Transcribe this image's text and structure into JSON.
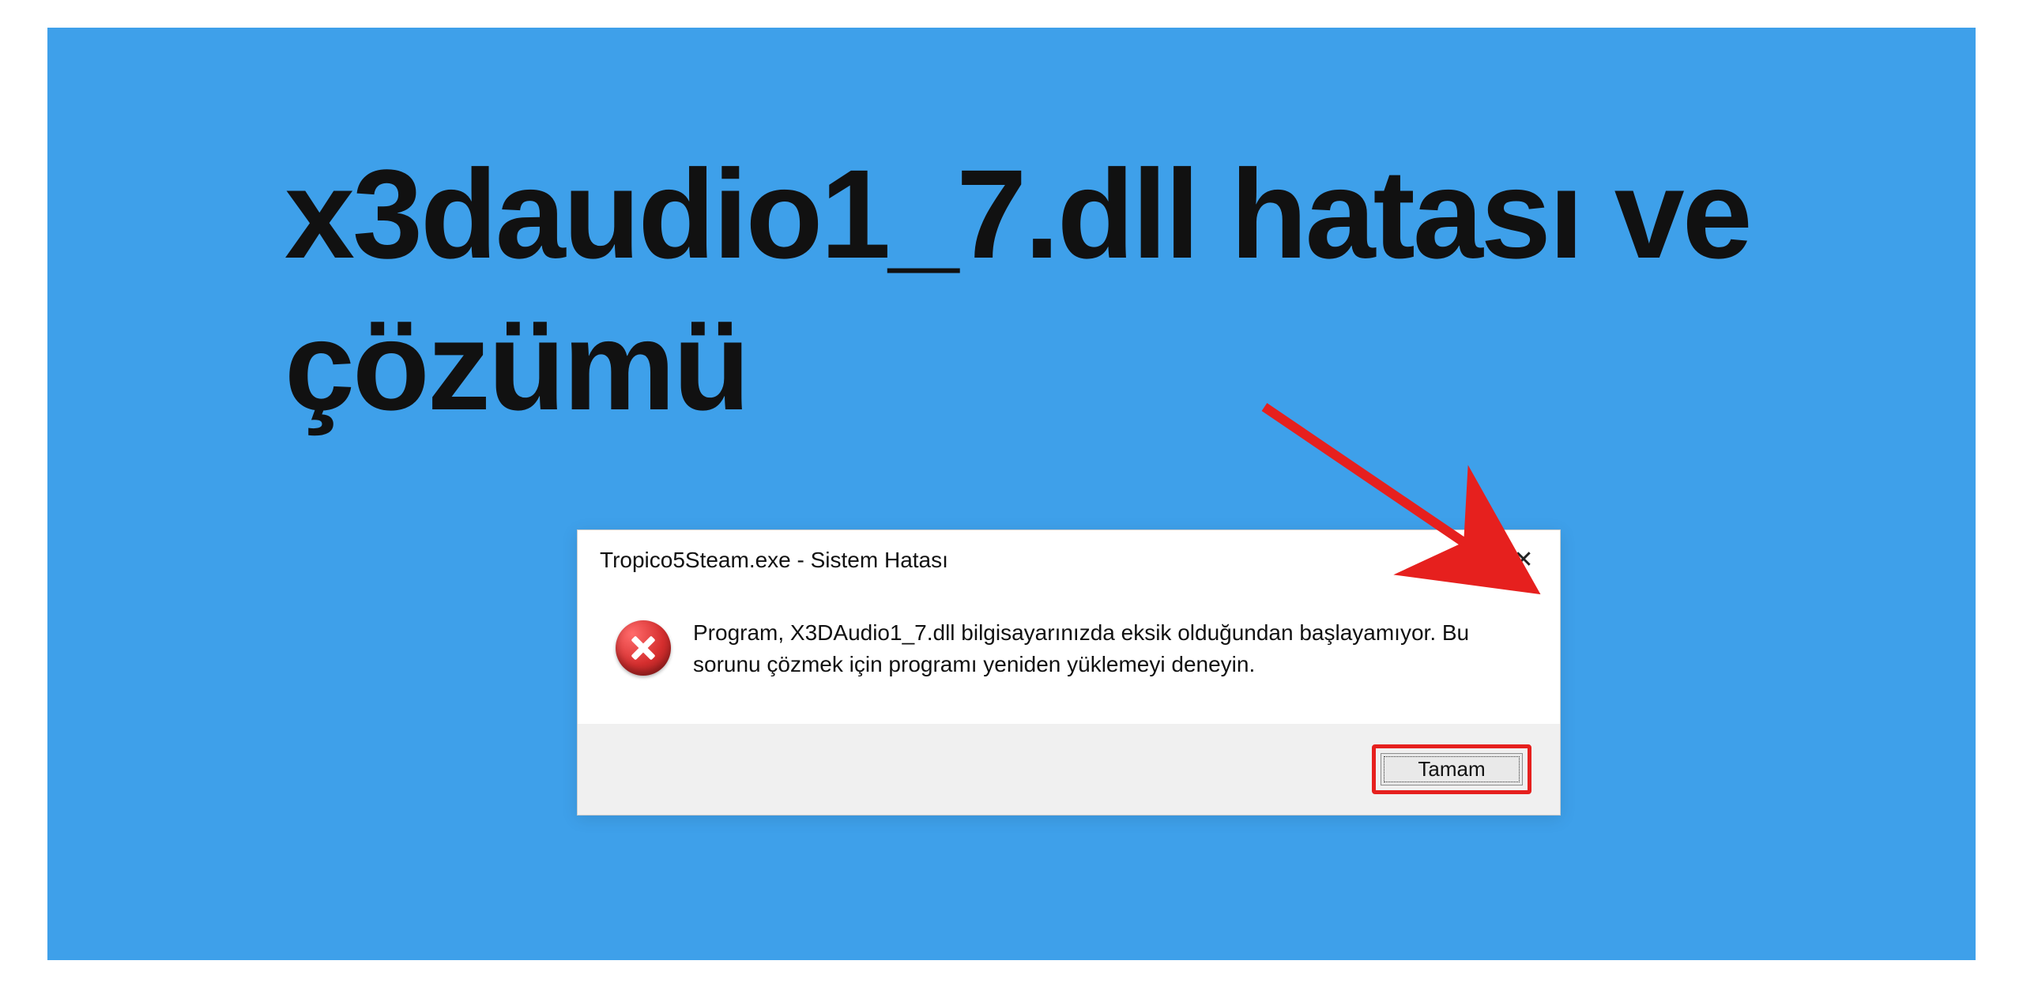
{
  "headline": "x3daudio1_7.dll hatası ve çözümü",
  "dialog": {
    "title": "Tropico5Steam.exe - Sistem Hatası",
    "close_label": "✕",
    "icon_name": "error",
    "message": "Program, X3DAudio1_7.dll bilgisayarınızda eksik olduğundan başlayamıyor. Bu sorunu çözmek için programı yeniden yüklemeyi deneyin.",
    "ok_label": "Tamam"
  },
  "colors": {
    "background": "#3ea0ea",
    "highlight": "#e6201e"
  }
}
